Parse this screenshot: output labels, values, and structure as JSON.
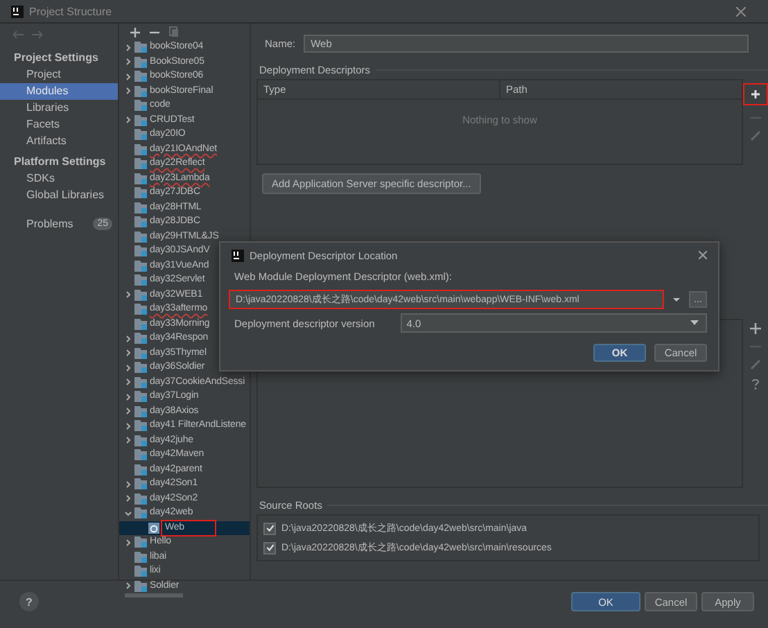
{
  "window": {
    "title": "Project Structure"
  },
  "sidebar": {
    "sections": [
      {
        "title": "Project Settings",
        "items": [
          {
            "label": "Project",
            "selected": false
          },
          {
            "label": "Modules",
            "selected": true
          },
          {
            "label": "Libraries",
            "selected": false
          },
          {
            "label": "Facets",
            "selected": false
          },
          {
            "label": "Artifacts",
            "selected": false
          }
        ]
      },
      {
        "title": "Platform Settings",
        "items": [
          {
            "label": "SDKs",
            "selected": false
          },
          {
            "label": "Global Libraries",
            "selected": false
          }
        ]
      }
    ],
    "problems": {
      "label": "Problems",
      "count": "25"
    }
  },
  "tree": [
    {
      "label": "bookStore04",
      "expandable": true,
      "error": false
    },
    {
      "label": "BookStore05",
      "expandable": true,
      "error": false
    },
    {
      "label": "bookStore06",
      "expandable": true,
      "error": false
    },
    {
      "label": "bookStoreFinal",
      "expandable": true,
      "error": false
    },
    {
      "label": "code",
      "expandable": false,
      "error": false
    },
    {
      "label": "CRUDTest",
      "expandable": true,
      "error": false
    },
    {
      "label": "day20IO",
      "expandable": false,
      "error": false
    },
    {
      "label": "day21IOAndNet",
      "expandable": false,
      "error": true
    },
    {
      "label": "day22Reflect",
      "expandable": false,
      "error": true
    },
    {
      "label": "day23Lambda",
      "expandable": false,
      "error": true
    },
    {
      "label": "day27JDBC",
      "expandable": false,
      "error": false
    },
    {
      "label": "day28HTML",
      "expandable": false,
      "error": false
    },
    {
      "label": "day28JDBC",
      "expandable": false,
      "error": false
    },
    {
      "label": "day29HTML&JS",
      "expandable": false,
      "error": false
    },
    {
      "label": "day30JSAndV",
      "expandable": false,
      "error": false
    },
    {
      "label": "day31VueAnd",
      "expandable": false,
      "error": false
    },
    {
      "label": "day32Servlet",
      "expandable": false,
      "error": false
    },
    {
      "label": "day32WEB1",
      "expandable": true,
      "error": false
    },
    {
      "label": "day33aftermo",
      "expandable": false,
      "error": true
    },
    {
      "label": "day33Morning",
      "expandable": false,
      "error": false
    },
    {
      "label": "day34Respon",
      "expandable": true,
      "error": false
    },
    {
      "label": "day35Thymel",
      "expandable": true,
      "error": false
    },
    {
      "label": "day36Soldier",
      "expandable": true,
      "error": false
    },
    {
      "label": "day37CookieAndSessi",
      "expandable": true,
      "error": false
    },
    {
      "label": "day37Login",
      "expandable": true,
      "error": false
    },
    {
      "label": "day38Axios",
      "expandable": true,
      "error": false
    },
    {
      "label": "day41 FilterAndListene",
      "expandable": true,
      "error": false
    },
    {
      "label": "day42juhe",
      "expandable": true,
      "error": false
    },
    {
      "label": "day42Maven",
      "expandable": false,
      "error": false
    },
    {
      "label": "day42parent",
      "expandable": false,
      "error": false
    },
    {
      "label": "day42Son1",
      "expandable": true,
      "error": false
    },
    {
      "label": "day42Son2",
      "expandable": true,
      "error": false
    },
    {
      "label": "day42web",
      "expandable": true,
      "expanded": true,
      "error": false,
      "children": [
        {
          "label": "Web",
          "kind": "web",
          "selected": true,
          "highlighted": true
        }
      ]
    },
    {
      "label": "Hello",
      "expandable": true,
      "error": false
    },
    {
      "label": "libai",
      "expandable": false,
      "error": false
    },
    {
      "label": "lixi",
      "expandable": false,
      "error": false
    },
    {
      "label": "Soldier",
      "expandable": true,
      "error": false
    }
  ],
  "name_field": {
    "label": "Name:",
    "value": "Web"
  },
  "descriptors": {
    "title": "Deployment Descriptors",
    "columns": [
      "Type",
      "Path"
    ],
    "empty": "Nothing to show",
    "add_highlighted": true,
    "button": "Add Application Server specific descriptor..."
  },
  "dialog": {
    "title": "Deployment Descriptor Location",
    "path_label": "Web Module Deployment Descriptor (web.xml):",
    "path": "D:\\java20220828\\成长之路\\code\\day42web\\src\\main\\webapp\\WEB-INF\\web.xml",
    "path_highlighted": true,
    "browse": "...",
    "version_label": "Deployment descriptor version",
    "version": "4.0",
    "buttons": [
      {
        "label": "OK",
        "primary": true
      },
      {
        "label": "Cancel",
        "primary": false
      }
    ]
  },
  "source_roots": {
    "title": "Source Roots",
    "items": [
      {
        "path": "D:\\java20220828\\成长之路\\code\\day42web\\src\\main\\java",
        "checked": true
      },
      {
        "path": "D:\\java20220828\\成长之路\\code\\day42web\\src\\main\\resources",
        "checked": true
      }
    ]
  },
  "footer": {
    "help": "?",
    "buttons": [
      {
        "label": "OK",
        "primary": true
      },
      {
        "label": "Cancel",
        "primary": false
      },
      {
        "label": "Apply",
        "primary": false
      }
    ]
  }
}
